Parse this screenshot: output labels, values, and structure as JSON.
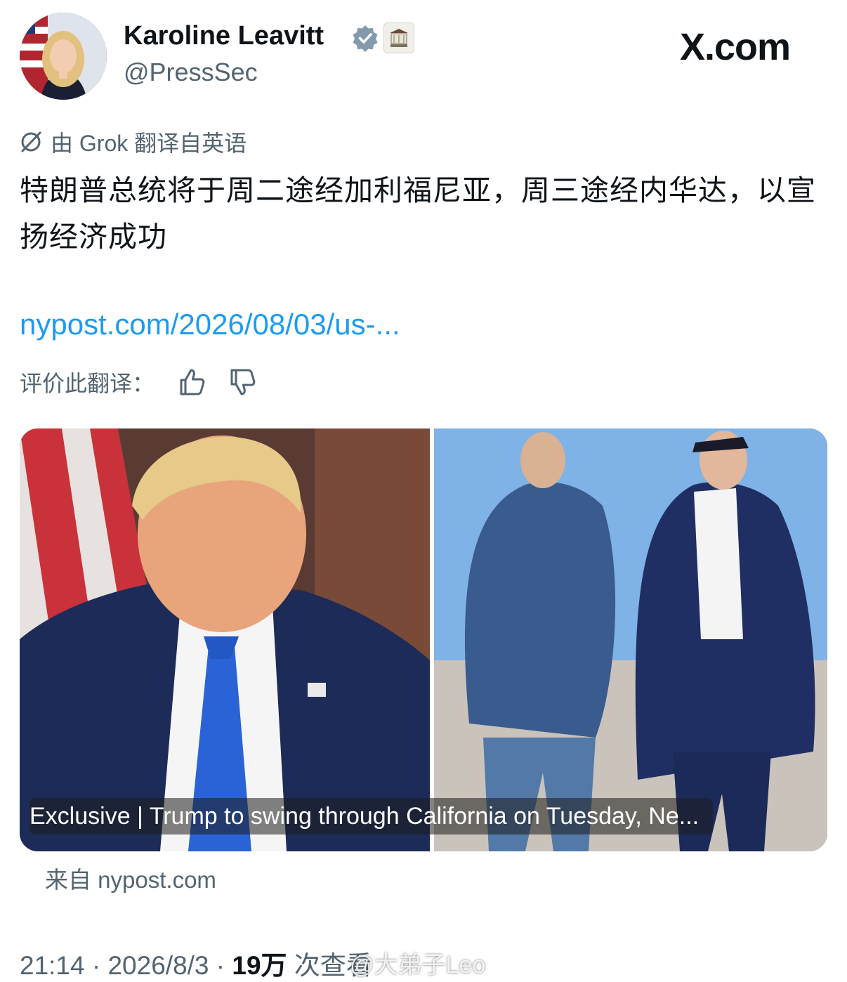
{
  "post": {
    "author_name": "Karoline Leavitt",
    "author_handle": "@PressSec",
    "brand": "X.com",
    "translation_notice": "由 Grok 翻译自英语",
    "text": "特朗普总统将于周二途经加利福尼亚，周三途经内华达，以宣扬经济成功",
    "link": "nypost.com/2026/08/03/us-...",
    "rate_translation_label": "评价此翻译：",
    "card": {
      "caption": "Exclusive | Trump to swing through California on Tuesday, Ne...",
      "source": "来自 nypost.com"
    },
    "meta": {
      "time": "21:14",
      "date": "2026/8/3",
      "views_count": "19万",
      "views_label": "次查看",
      "separator": "·"
    },
    "watermark": "@大弟子Leo"
  },
  "colors": {
    "text_primary": "#0f1419",
    "text_secondary": "#536471",
    "link": "#1d9bf0",
    "verified": "#1d9bf0"
  },
  "icons": {
    "verified": "verified-badge-icon",
    "affiliate": "white-house-affiliate-icon",
    "grok": "grok-translate-icon",
    "thumbs_up": "thumbs-up-icon",
    "thumbs_down": "thumbs-down-icon"
  }
}
